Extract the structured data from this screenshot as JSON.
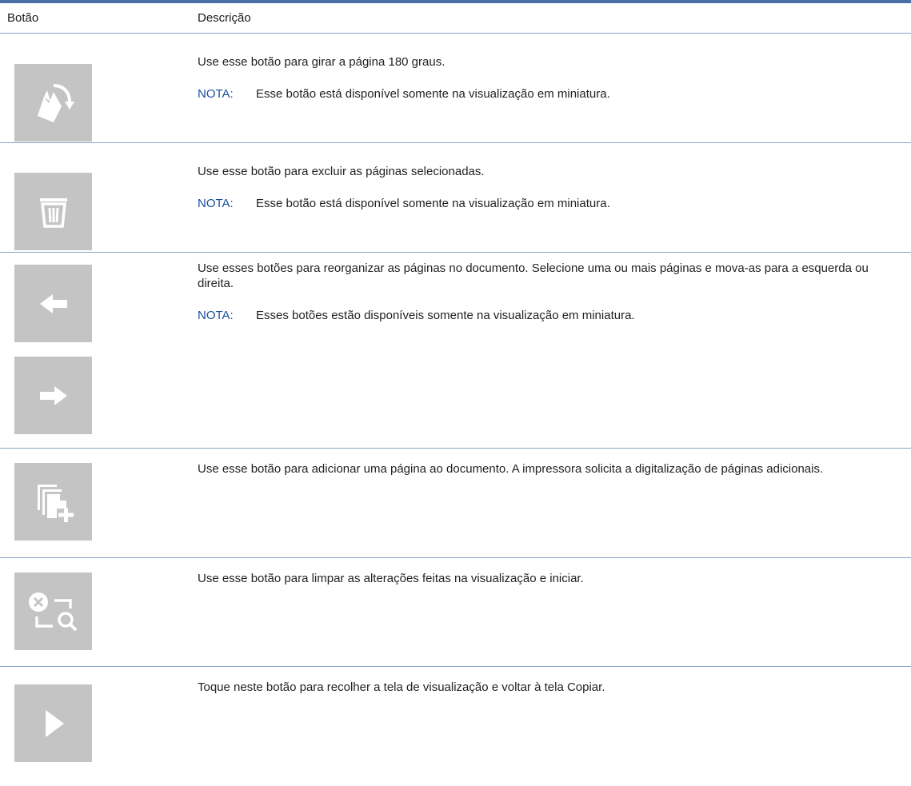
{
  "table": {
    "headers": {
      "button": "Botão",
      "description": "Descrição"
    },
    "rows": [
      {
        "icons": [
          "rotate-page-icon"
        ],
        "description": "Use esse botão para girar a página 180 graus.",
        "note_label": "NOTA:",
        "note_text": "Esse botão está disponível somente na visualização em miniatura."
      },
      {
        "icons": [
          "trash-icon"
        ],
        "description": "Use esse botão para excluir as páginas selecionadas.",
        "note_label": "NOTA:",
        "note_text": "Esse botão está disponível somente na visualização em miniatura."
      },
      {
        "icons": [
          "arrow-left-icon",
          "arrow-right-icon"
        ],
        "description": "Use esses botões para reorganizar as páginas no documento. Selecione uma ou mais páginas e mova-as para a esquerda ou direita.",
        "note_label": "NOTA:",
        "note_text": "Esses botões estão disponíveis somente na visualização em miniatura."
      },
      {
        "icons": [
          "add-page-icon"
        ],
        "description": "Use esse botão para adicionar uma página ao documento. A impressora solicita a digitalização de páginas adicionais."
      },
      {
        "icons": [
          "reset-preview-icon"
        ],
        "description": "Use esse botão para limpar as alterações feitas na visualização e iniciar."
      },
      {
        "icons": [
          "collapse-play-icon"
        ],
        "description": "Toque neste botão para recolher a tela de visualização e voltar à tela Copiar."
      }
    ]
  },
  "colors": {
    "rule": "#4a6fa5",
    "note_label": "#1a4fa0",
    "button_bg": "#c4c4c4",
    "icon_fg": "#ffffff"
  }
}
